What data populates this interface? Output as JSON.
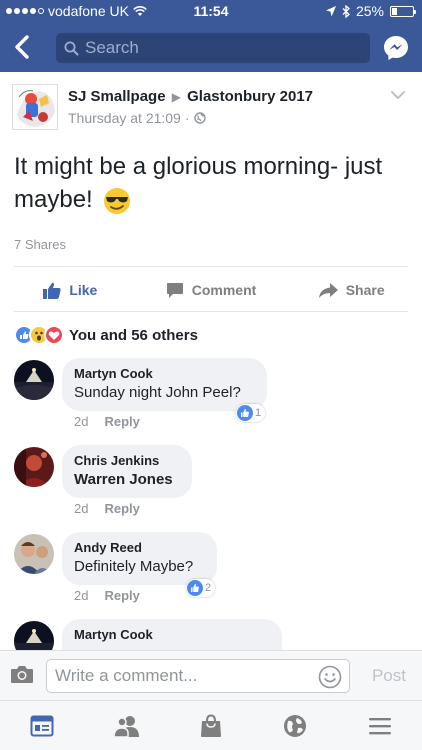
{
  "status_bar": {
    "carrier": "vodafone UK",
    "time": "11:54",
    "battery": "25%",
    "battery_level": 0.25
  },
  "navbar": {
    "search_placeholder": "Search"
  },
  "post": {
    "author": "SJ Smallpage",
    "group": "Glastonbury 2017",
    "timestamp": "Thursday at 21:09",
    "text": "It might be a glorious morning- just maybe!",
    "shares": "7 Shares",
    "actions": {
      "like": "Like",
      "comment": "Comment",
      "share": "Share"
    },
    "reactions_summary": "You and 56 others"
  },
  "comments": [
    {
      "name": "Martyn Cook",
      "text": "Sunday night John Peel?",
      "time": "2d",
      "reply": "Reply",
      "likes": "1",
      "text_bold": false
    },
    {
      "name": "Chris Jenkins",
      "text": "Warren Jones",
      "time": "2d",
      "reply": "Reply",
      "likes": "",
      "text_bold": true
    },
    {
      "name": "Andy Reed",
      "text": "Definitely Maybe?",
      "time": "2d",
      "reply": "Reply",
      "likes": "2",
      "text_bold": false
    },
    {
      "name": "Martyn Cook",
      "text": "",
      "time": "",
      "reply": "",
      "likes": "",
      "text_bold": false
    }
  ],
  "composer": {
    "placeholder": "Write a comment...",
    "post_label": "Post"
  },
  "colors": {
    "brand": "#3b5998",
    "like_blue": "#4267b2",
    "bubble": "#f0f1f4"
  },
  "icons": {
    "tabs": [
      "news-feed-icon",
      "friends-icon",
      "marketplace-icon",
      "notifications-globe-icon",
      "menu-icon"
    ]
  }
}
